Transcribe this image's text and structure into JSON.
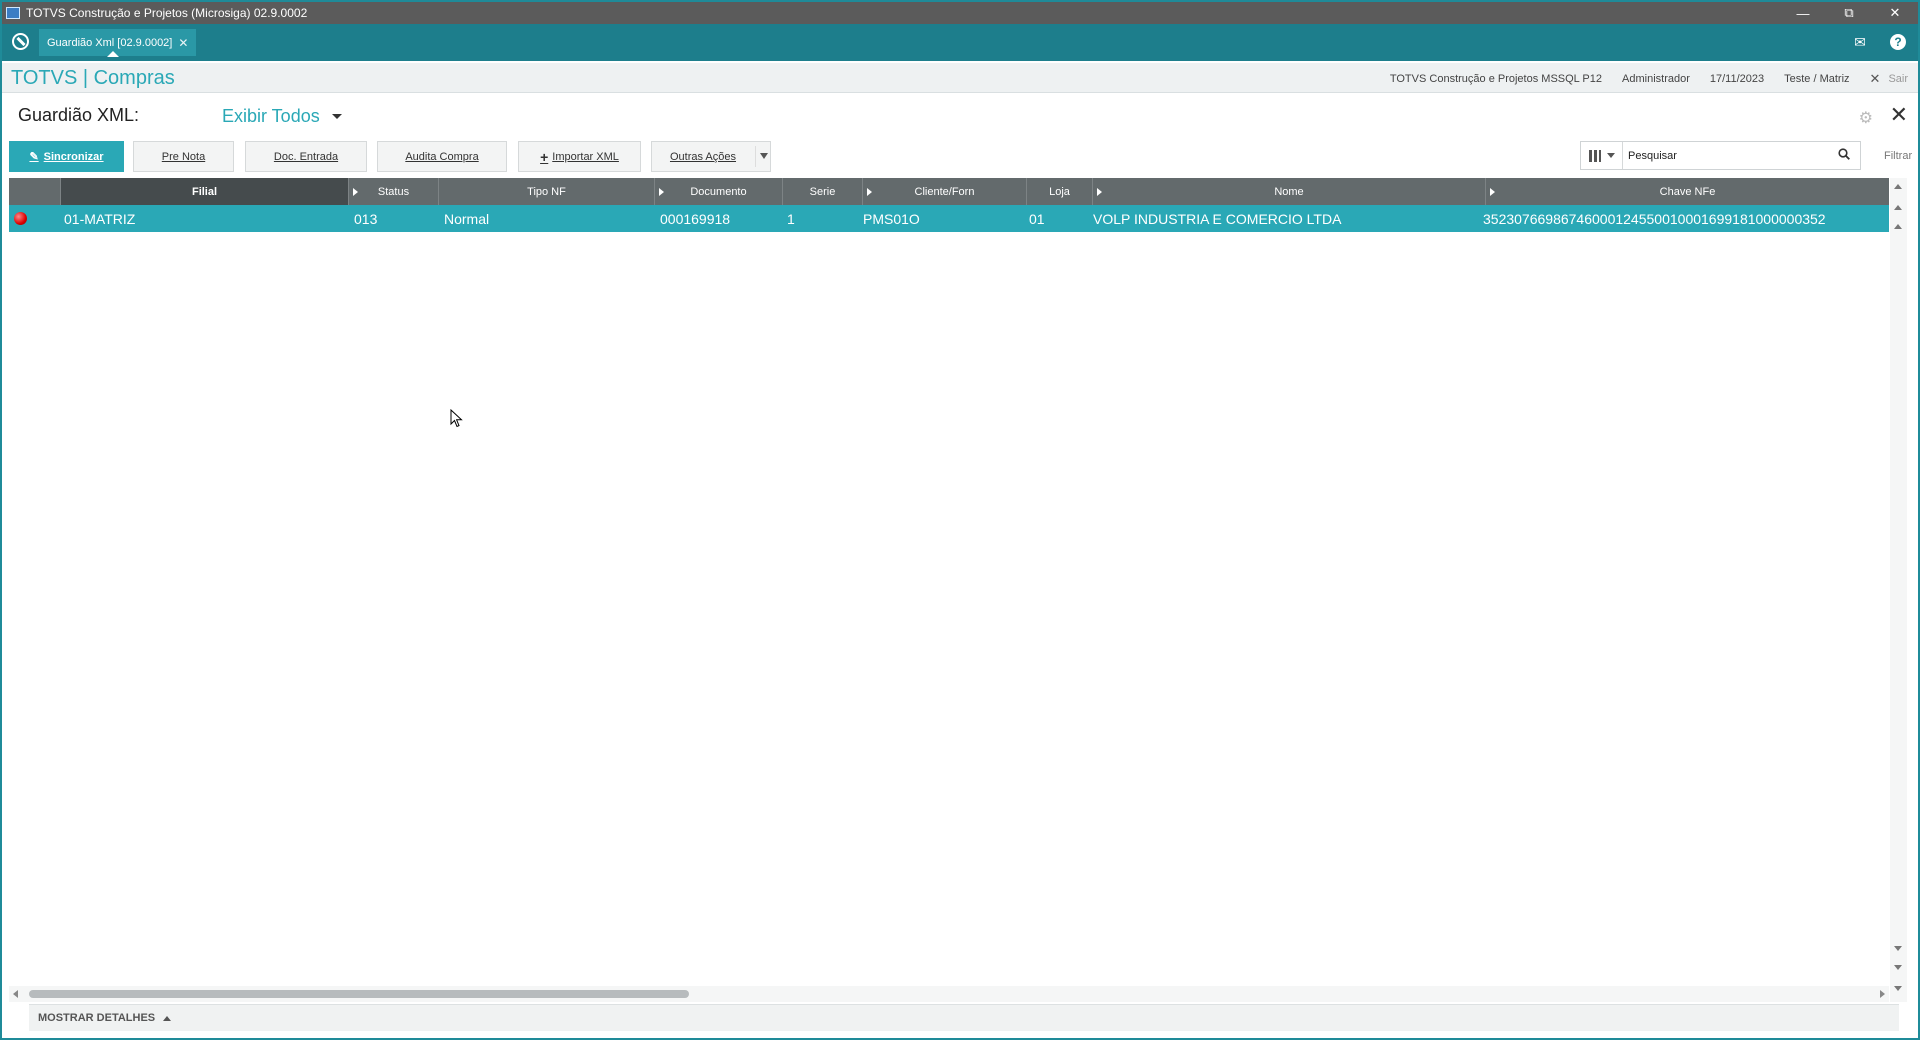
{
  "window": {
    "title": "TOTVS Construção e Projetos (Microsiga) 02.9.0002"
  },
  "tabs": [
    {
      "label": "Guardião Xml [02.9.0002]"
    }
  ],
  "header": {
    "brand": "TOTVS | Compras",
    "environment": "TOTVS Construção e Projetos MSSQL P12",
    "user": "Administrador",
    "date": "17/11/2023",
    "company": "Teste / Matriz",
    "exit_label": "Sair"
  },
  "page": {
    "title": "Guardião XML:",
    "view_label": "Exibir Todos"
  },
  "toolbar": {
    "sync_label": "Sincronizar",
    "pre_nota_label": "Pre Nota",
    "doc_entrada_label": "Doc. Entrada",
    "audita_label": "Audita Compra",
    "importar_label": "Importar XML",
    "outras_label": "Outras Ações"
  },
  "search": {
    "value": "Pesquisar",
    "filter_label": "Filtrar"
  },
  "grid": {
    "columns": [
      "Filial",
      "Status",
      "Tipo NF",
      "Documento",
      "Serie",
      "Cliente/Forn",
      "Loja",
      "Nome",
      "Chave NFe"
    ],
    "rows": [
      {
        "status_icon": "red-dot-icon",
        "filial": "01-MATRIZ",
        "status": "013",
        "tipo_nf": "Normal",
        "documento": "000169918",
        "serie": "1",
        "cliente_forn": "PMS01O",
        "loja": "01",
        "nome": "VOLP INDUSTRIA E COMERCIO LTDA",
        "chave_nfe": "35230766986746000124550010001699181000000352"
      }
    ]
  },
  "footer": {
    "details_label": "MOSTRAR DETALHES"
  },
  "colors": {
    "accent": "#2aa8b6",
    "tabbar": "#1d7e8c",
    "header_grid": "#636a6c",
    "status_red": "#dd0000"
  }
}
